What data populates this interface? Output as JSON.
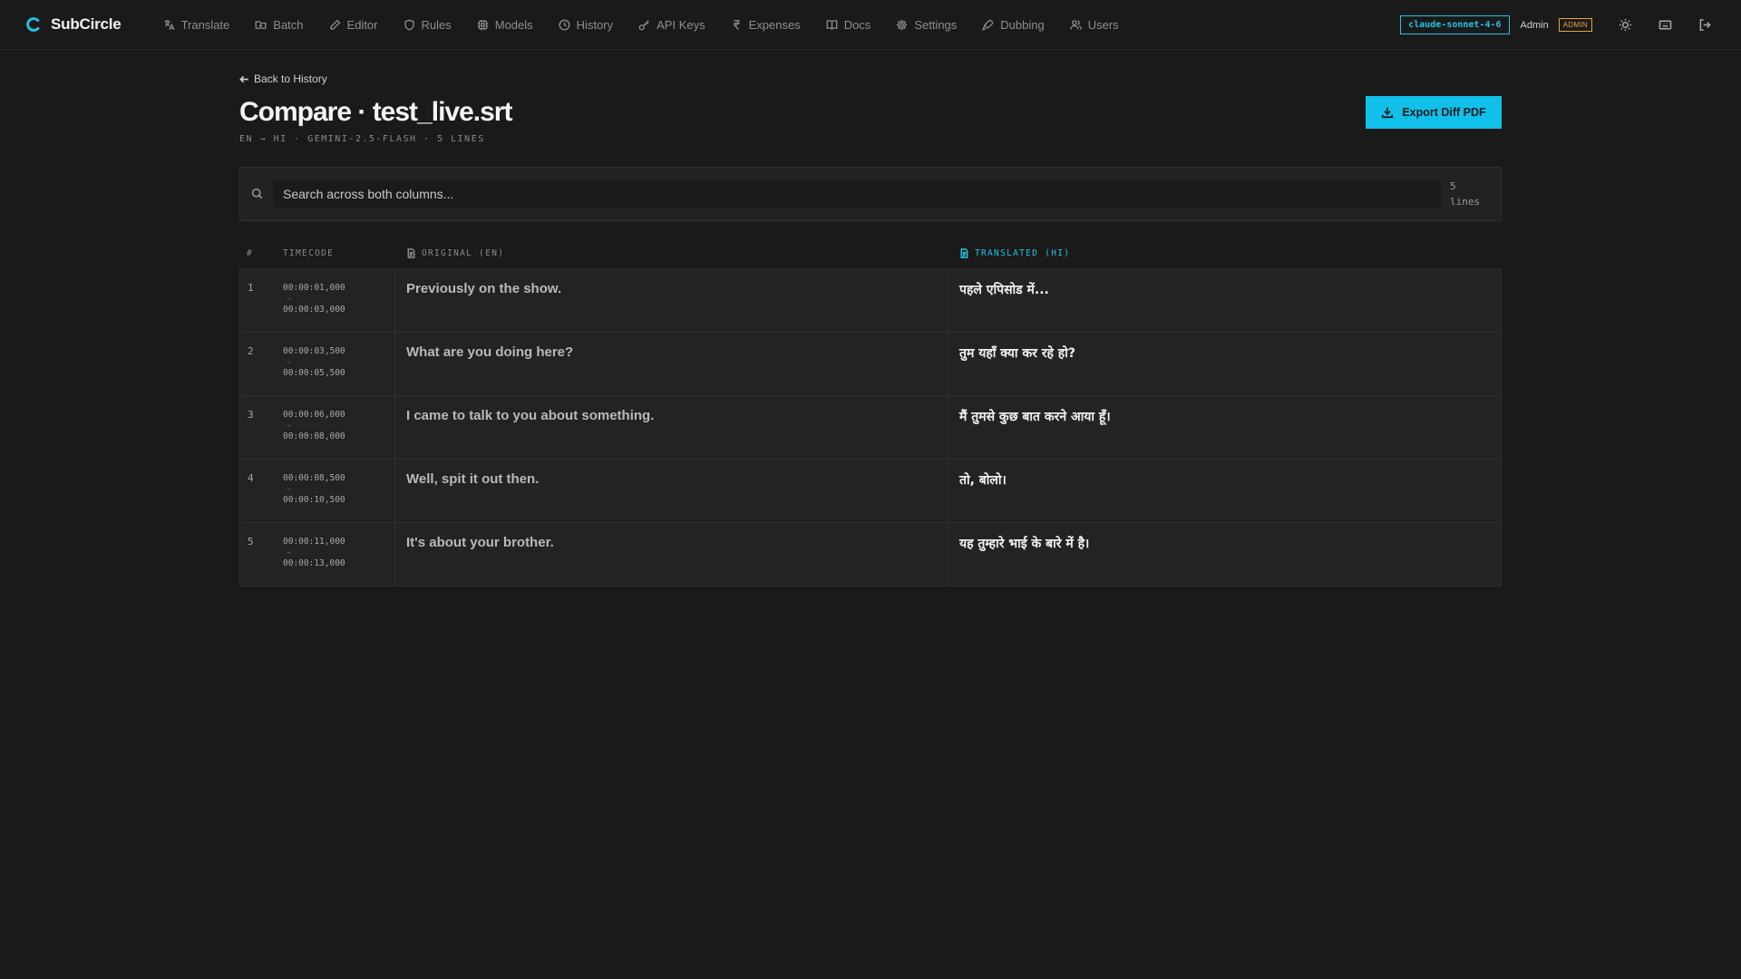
{
  "brand": {
    "name": "SubCircle",
    "accent": "#22c3e6"
  },
  "nav": [
    {
      "label": "Translate",
      "icon": "languages-icon"
    },
    {
      "label": "Batch",
      "icon": "folder-icon"
    },
    {
      "label": "Editor",
      "icon": "pencil-icon"
    },
    {
      "label": "Rules",
      "icon": "shield-icon"
    },
    {
      "label": "Models",
      "icon": "cpu-icon"
    },
    {
      "label": "History",
      "icon": "clock-icon"
    },
    {
      "label": "API Keys",
      "icon": "key-icon"
    },
    {
      "label": "Expenses",
      "icon": "rupee-icon"
    },
    {
      "label": "Docs",
      "icon": "book-icon"
    },
    {
      "label": "Settings",
      "icon": "gear-icon"
    },
    {
      "label": "Dubbing",
      "icon": "mic-icon"
    },
    {
      "label": "Users",
      "icon": "users-icon"
    }
  ],
  "topbar": {
    "model": "claude-sonnet-4-6",
    "user": "Admin",
    "role_badge": "ADMIN",
    "badge_color": "#e8a33b"
  },
  "page": {
    "back_label": "Back to History",
    "title": "Compare · test_live.srt",
    "meta": "EN → HI · GEMINI-2.5-FLASH · 5 LINES",
    "export_label": "Export Diff PDF"
  },
  "search": {
    "placeholder": "Search across both columns...",
    "value": "",
    "count": "5 lines"
  },
  "table": {
    "headers": {
      "num": "#",
      "timecode": "TIMECODE",
      "original": "ORIGINAL (EN)",
      "translated": "TRANSLATED (HI)"
    },
    "rows": [
      {
        "num": "1",
        "start": "00:00:01,000",
        "arrow": "→",
        "end": "00:00:03,000",
        "original": "Previously on the show.",
        "translated": "पहले एपिसोड में..."
      },
      {
        "num": "2",
        "start": "00:00:03,500",
        "arrow": "→",
        "end": "00:00:05,500",
        "original": "What are you doing here?",
        "translated": "तुम यहाँ क्या कर रहे हो?"
      },
      {
        "num": "3",
        "start": "00:00:06,000",
        "arrow": "→",
        "end": "00:00:08,000",
        "original": "I came to talk to you about something.",
        "translated": "मैं तुमसे कुछ बात करने आया हूँ।"
      },
      {
        "num": "4",
        "start": "00:00:08,500",
        "arrow": "→",
        "end": "00:00:10,500",
        "original": "Well, spit it out then.",
        "translated": "तो, बोलो।"
      },
      {
        "num": "5",
        "start": "00:00:11,000",
        "arrow": "→",
        "end": "00:00:13,000",
        "original": "It's about your brother.",
        "translated": "यह तुम्हारे भाई के बारे में है।"
      }
    ]
  }
}
